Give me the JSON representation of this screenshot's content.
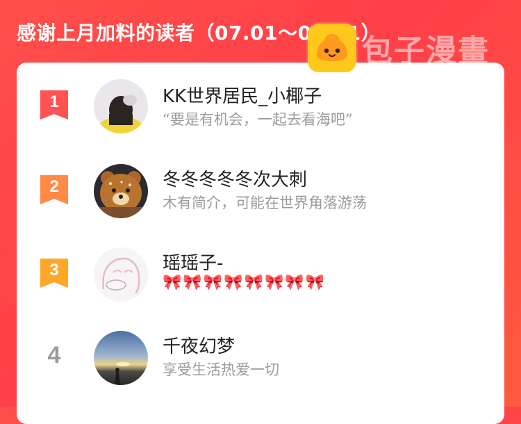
{
  "header": {
    "title": "感谢上月加料的读者（07.01～07.31）"
  },
  "watermark": {
    "text": "包子漫畫",
    "logo": "bun-mascot-logo"
  },
  "leaderboard": [
    {
      "rank": "1",
      "name": "KK世界居民_小椰子",
      "subtitle": "“要是有机会，一起去看海吧”",
      "badge_color": "#ff5252"
    },
    {
      "rank": "2",
      "name": "冬冬冬冬冬次大刺",
      "subtitle": "木有简介，可能在世界角落游荡",
      "badge_color": "#ff8a45"
    },
    {
      "rank": "3",
      "name": "瑶瑶子-",
      "subtitle": "🎀🎀🎀🎀🎀🎀🎀🎀",
      "badge_color": "#ffa726"
    },
    {
      "rank": "4",
      "name": "千夜幻梦",
      "subtitle": "享受生活热爱一切",
      "badge_color": ""
    }
  ]
}
